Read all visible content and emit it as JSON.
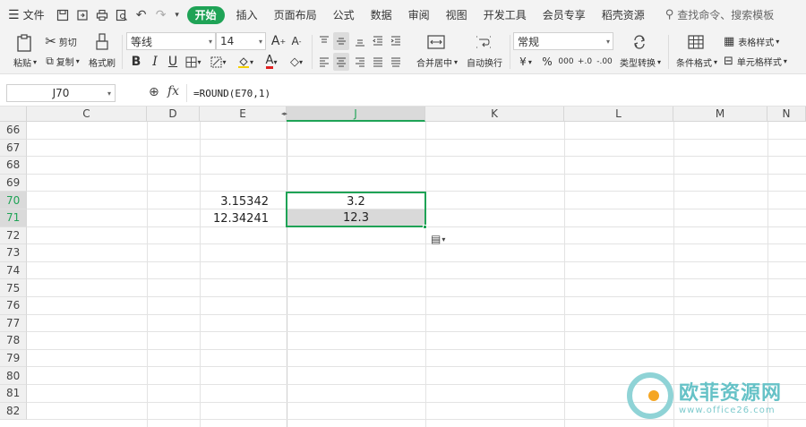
{
  "menubar": {
    "file": "文件",
    "tabs": [
      "开始",
      "插入",
      "页面布局",
      "公式",
      "数据",
      "审阅",
      "视图",
      "开发工具",
      "会员专享",
      "稻壳资源"
    ],
    "active_tab": "开始",
    "search": "查找命令、搜索模板"
  },
  "ribbon": {
    "paste": "粘贴",
    "cut": "剪切",
    "copy": "复制",
    "format_painter": "格式刷",
    "font_name": "等线",
    "font_size": "14",
    "merge_center": "合并居中",
    "wrap_text": "自动换行",
    "number_format": "常规",
    "type_convert": "类型转换",
    "conditional_format": "条件格式",
    "table_style": "表格样式",
    "cell_style": "单元格样式",
    "percent": "%",
    "thousands": "000",
    "inc_decimal": "+.0",
    "dec_decimal": "-.00",
    "currency": "¥"
  },
  "formula_bar": {
    "name_box": "J70",
    "fx": "fx",
    "formula": "=ROUND(E70,1)"
  },
  "grid": {
    "columns": [
      "C",
      "D",
      "E",
      "J",
      "K",
      "L",
      "M",
      "N"
    ],
    "selected_column": "J",
    "rows": [
      "66",
      "67",
      "68",
      "69",
      "70",
      "71",
      "72",
      "73",
      "74",
      "75",
      "76",
      "77",
      "78",
      "79",
      "80",
      "81",
      "82"
    ],
    "selected_rows": [
      "70",
      "71"
    ],
    "cells": {
      "E70": "3.15342",
      "J70": "3.2",
      "E71": "12.34241",
      "J71": "12.3"
    }
  },
  "watermark": {
    "name": "欧菲资源网",
    "url": "www.office26.com"
  },
  "colors": {
    "accent": "#1fa356",
    "selection_shade": "#d9d9d9"
  }
}
